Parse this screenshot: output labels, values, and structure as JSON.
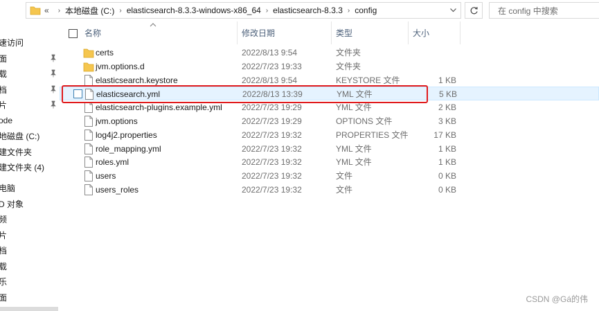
{
  "address_bar": {
    "lead": "«",
    "path": [
      "本地磁盘 (C:)",
      "elasticsearch-8.3.3-windows-x86_64",
      "elasticsearch-8.3.3",
      "config"
    ]
  },
  "search": {
    "placeholder": "在 config 中搜索"
  },
  "nav": {
    "items": [
      {
        "label": "速访问",
        "pinned": false
      },
      {
        "label": "面",
        "pinned": true
      },
      {
        "label": "载",
        "pinned": true
      },
      {
        "label": "档",
        "pinned": true
      },
      {
        "label": "片",
        "pinned": true
      },
      {
        "label": "ode",
        "pinned": false
      },
      {
        "label": "地磁盘 (C:)",
        "pinned": false
      },
      {
        "label": "建文件夹",
        "pinned": false
      },
      {
        "label": "建文件夹 (4)",
        "pinned": false
      },
      {
        "label": "电脑",
        "pinned": false
      },
      {
        "label": "D 对象",
        "pinned": false
      },
      {
        "label": "频",
        "pinned": false
      },
      {
        "label": "片",
        "pinned": false
      },
      {
        "label": "档",
        "pinned": false
      },
      {
        "label": "载",
        "pinned": false
      },
      {
        "label": "乐",
        "pinned": false
      },
      {
        "label": "面",
        "pinned": false
      }
    ]
  },
  "columns": {
    "name": "名称",
    "date": "修改日期",
    "type": "类型",
    "size": "大小"
  },
  "files": [
    {
      "name": "certs",
      "date": "2022/8/13 9:54",
      "type": "文件夹",
      "size": "",
      "icon": "folder-icon"
    },
    {
      "name": "jvm.options.d",
      "date": "2022/7/23 19:33",
      "type": "文件夹",
      "size": "",
      "icon": "folder-icon"
    },
    {
      "name": "elasticsearch.keystore",
      "date": "2022/8/13 9:54",
      "type": "KEYSTORE 文件",
      "size": "1 KB",
      "icon": "file-icon"
    },
    {
      "name": "elasticsearch.yml",
      "date": "2022/8/13 13:39",
      "type": "YML 文件",
      "size": "5 KB",
      "icon": "file-icon",
      "selected": true
    },
    {
      "name": "elasticsearch-plugins.example.yml",
      "date": "2022/7/23 19:29",
      "type": "YML 文件",
      "size": "2 KB",
      "icon": "file-icon"
    },
    {
      "name": "jvm.options",
      "date": "2022/7/23 19:29",
      "type": "OPTIONS 文件",
      "size": "3 KB",
      "icon": "file-icon"
    },
    {
      "name": "log4j2.properties",
      "date": "2022/7/23 19:32",
      "type": "PROPERTIES 文件",
      "size": "17 KB",
      "icon": "file-icon"
    },
    {
      "name": "role_mapping.yml",
      "date": "2022/7/23 19:32",
      "type": "YML 文件",
      "size": "1 KB",
      "icon": "file-icon"
    },
    {
      "name": "roles.yml",
      "date": "2022/7/23 19:32",
      "type": "YML 文件",
      "size": "1 KB",
      "icon": "file-icon"
    },
    {
      "name": "users",
      "date": "2022/7/23 19:32",
      "type": "文件",
      "size": "0 KB",
      "icon": "file-icon"
    },
    {
      "name": "users_roles",
      "date": "2022/7/23 19:32",
      "type": "文件",
      "size": "0 KB",
      "icon": "file-icon"
    }
  ],
  "watermark": "CSDN @Gá的伟",
  "colors": {
    "folder": "#f5c64f",
    "selection": "#e5f3ff",
    "highlight": "#e0191b",
    "header_text": "#4c607a"
  }
}
